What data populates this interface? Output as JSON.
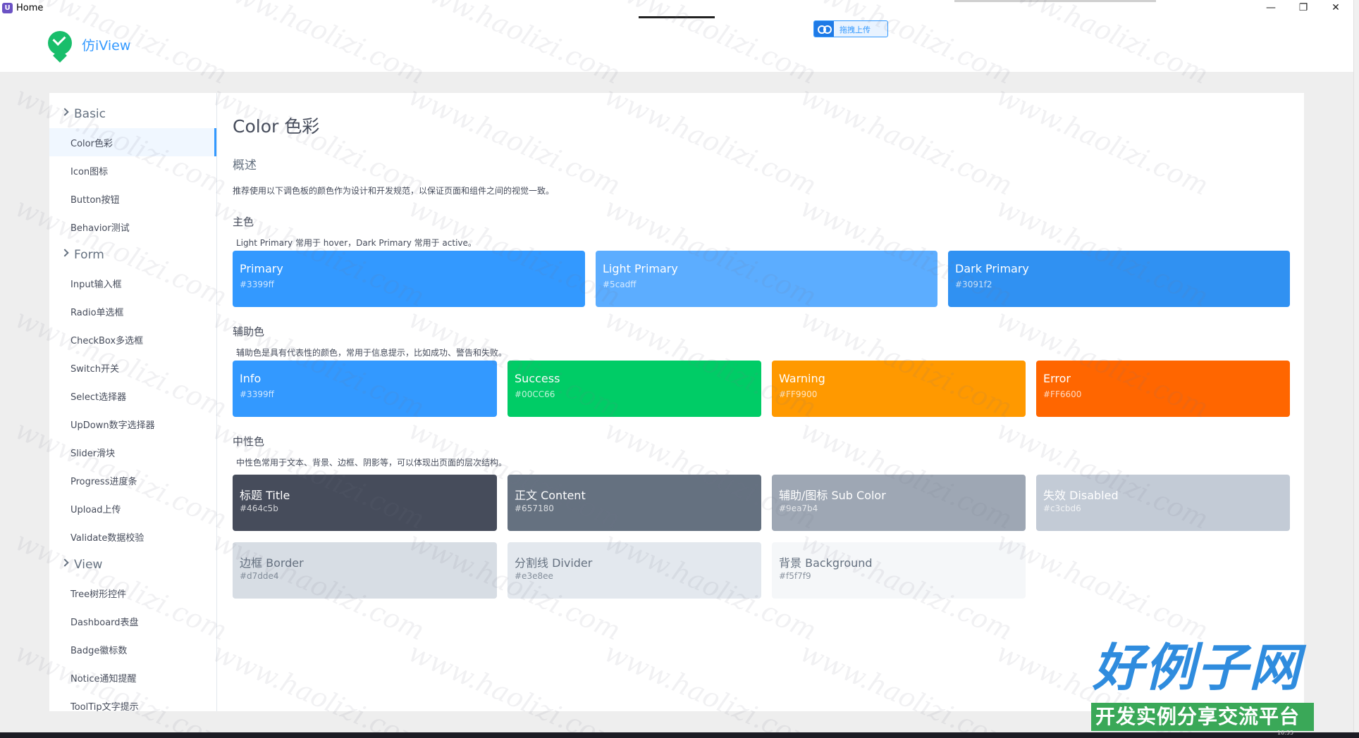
{
  "window": {
    "title": "Home",
    "app_icon_letter": "U",
    "minimize_glyph": "—",
    "maximize_glyph": "❐",
    "close_glyph": "✕"
  },
  "float_widget": {
    "label": "拖拽上传",
    "icon": "cloud-upload-icon"
  },
  "header": {
    "logo_text": "仿iView",
    "logo_icon": "leaf-logo-icon"
  },
  "sidebar": {
    "groups": [
      {
        "label": "Basic",
        "items": [
          "Color色彩",
          "Icon图标",
          "Button按钮",
          "Behavior测试"
        ]
      },
      {
        "label": "Form",
        "items": [
          "Input输入框",
          "Radio单选框",
          "CheckBox多选框",
          "Switch开关",
          "Select选择器",
          "UpDown数字选择器",
          "Slider滑块",
          "Progress进度条",
          "Upload上传",
          "Validate数据校验"
        ]
      },
      {
        "label": "View",
        "items": [
          "Tree树形控件",
          "Dashboard表盘",
          "Badge徽标数",
          "Notice通知提醒",
          "ToolTip文字提示"
        ]
      }
    ],
    "active_item": "Color色彩"
  },
  "content": {
    "page_title": "Color 色彩",
    "overview_heading": "概述",
    "overview_text": "推荐使用以下调色板的颜色作为设计和开发规范，以保证页面和组件之间的视觉一致。",
    "primary": {
      "heading": "主色",
      "desc": "Light Primary 常用于 hover，Dark Primary 常用于 active。",
      "swatches": [
        {
          "name": "Primary",
          "hex": "#3399ff",
          "color": "#3399ff"
        },
        {
          "name": "Light Primary",
          "hex": "#5cadff",
          "color": "#5cadff"
        },
        {
          "name": "Dark Primary",
          "hex": "#3091f2",
          "color": "#3091f2"
        }
      ]
    },
    "secondary": {
      "heading": "辅助色",
      "desc": "辅助色是具有代表性的颜色，常用于信息提示，比如成功、警告和失败。",
      "swatches": [
        {
          "name": "Info",
          "hex": "#3399ff",
          "color": "#3399ff"
        },
        {
          "name": "Success",
          "hex": "#00CC66",
          "color": "#00cc66"
        },
        {
          "name": "Warning",
          "hex": "#FF9900",
          "color": "#ff9900"
        },
        {
          "name": "Error",
          "hex": "#FF6600",
          "color": "#ff6600"
        }
      ]
    },
    "neutral": {
      "heading": "中性色",
      "desc": "中性色常用于文本、背景、边框、阴影等，可以体现出页面的层次结构。",
      "swatches": [
        {
          "name": "标题 Title",
          "hex": "#464c5b",
          "color": "#464c5b"
        },
        {
          "name": "正文 Content",
          "hex": "#657180",
          "color": "#657180"
        },
        {
          "name": "辅助/图标 Sub Color",
          "hex": "#9ea7b4",
          "color": "#9ea7b4"
        },
        {
          "name": "失效 Disabled",
          "hex": "#c3cbd6",
          "color": "#c3cbd6"
        },
        {
          "name": "边框 Border",
          "hex": "#d7dde4",
          "color": "#d7dde4"
        },
        {
          "name": "分割线 Divider",
          "hex": "#e3e8ee",
          "color": "#e3e8ee"
        },
        {
          "name": "背景 Background",
          "hex": "#f5f7f9",
          "color": "#f5f7f9"
        }
      ]
    }
  },
  "watermark": "www.haolizi.com",
  "branding": {
    "big_text": "好例子网",
    "small_text": "开发实例分享交流平台"
  },
  "taskbar": {
    "time": "10:55"
  },
  "colors": {
    "accent": "#3399ff",
    "logo_green": "#19be6b",
    "page_bg": "#eeeeee"
  }
}
